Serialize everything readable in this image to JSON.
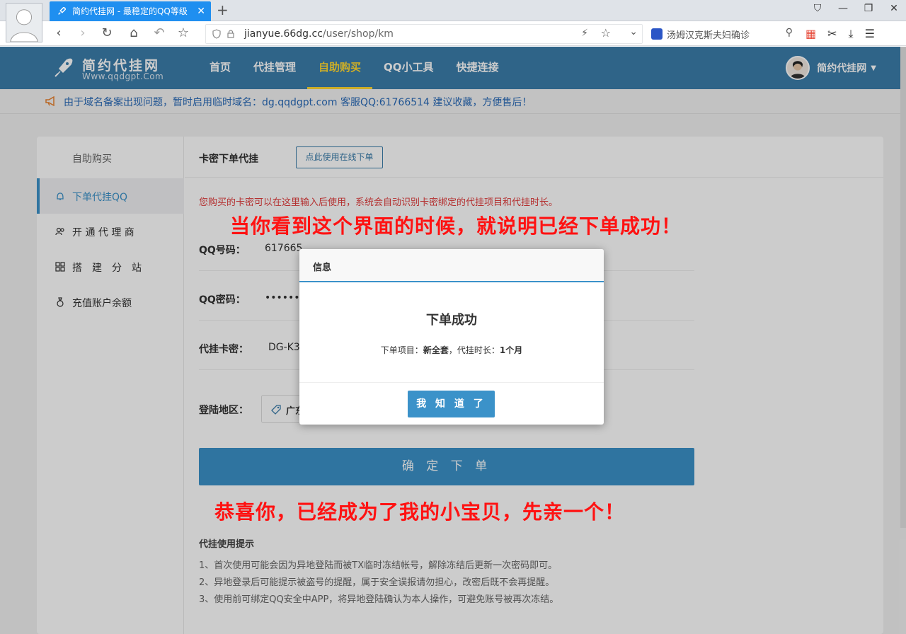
{
  "browser": {
    "tab_title": "简约代挂网 - 最稳定的QQ等级",
    "url_domain": "jianyue.66dg.cc",
    "url_path": "/user/shop/km",
    "search_text": "汤姆汉克斯夫妇确诊"
  },
  "header": {
    "brand": "简约代挂网",
    "domain": "Www.qqdgpt.Com",
    "nav": [
      {
        "label": "首页"
      },
      {
        "label": "代挂管理"
      },
      {
        "label": "自助购买"
      },
      {
        "label": "QQ小工具"
      },
      {
        "label": "快捷连接"
      }
    ],
    "username": "简约代挂网"
  },
  "notice": "由于域名备案出现问题，暂时启用临时域名：dg.qqdgpt.com 客服QQ:61766514 建议收藏，方便售后！",
  "sidebar": {
    "title": "自助购买",
    "items": [
      {
        "label": "下单代挂QQ"
      },
      {
        "label": "开 通 代 理 商"
      },
      {
        "label": "搭　建　分　站"
      },
      {
        "label": "充值账户余额"
      }
    ]
  },
  "content": {
    "title": "卡密下单代挂",
    "online_button": "点此使用在线下单",
    "hint": "您购买的卡密可以在这里输入后使用，系统会自动识别卡密绑定的代挂项目和代挂时长。",
    "fields": [
      {
        "label": "QQ号码：",
        "value": "617665"
      },
      {
        "label": "QQ密码：",
        "value": "•••••••"
      },
      {
        "label": "代挂卡密：",
        "value": "DG-K3"
      }
    ],
    "region_label": "登陆地区：",
    "region_value": "广东",
    "submit": "确 定 下 单",
    "tips_title": "代挂使用提示",
    "tips": [
      "1、首次使用可能会因为异地登陆而被TX临时冻结帐号，解除冻结后更新一次密码即可。",
      "2、异地登录后可能提示被盗号的提醒，属于安全误报请勿担心，改密后既不会再提醒。",
      "3、使用前可绑定QQ安全中APP，将异地登陆确认为本人操作，可避免账号被再次冻结。"
    ]
  },
  "annotations": {
    "top": "当你看到这个界面的时候，就说明已经下单成功！",
    "bottom": "恭喜你，已经成为了我的小宝贝，先亲一个！"
  },
  "modal": {
    "title": "信息",
    "heading": "下单成功",
    "item_label": "下单项目：",
    "item_value": "新全套",
    "duration_label": "，代挂时长：",
    "duration_value": "1个月",
    "button": "我 知 道 了"
  },
  "colors": {
    "header_blue": "#3b7dab",
    "accent_blue": "#3b92c9",
    "active_nav": "#ffd932",
    "annotation_red": "#ff1212"
  }
}
